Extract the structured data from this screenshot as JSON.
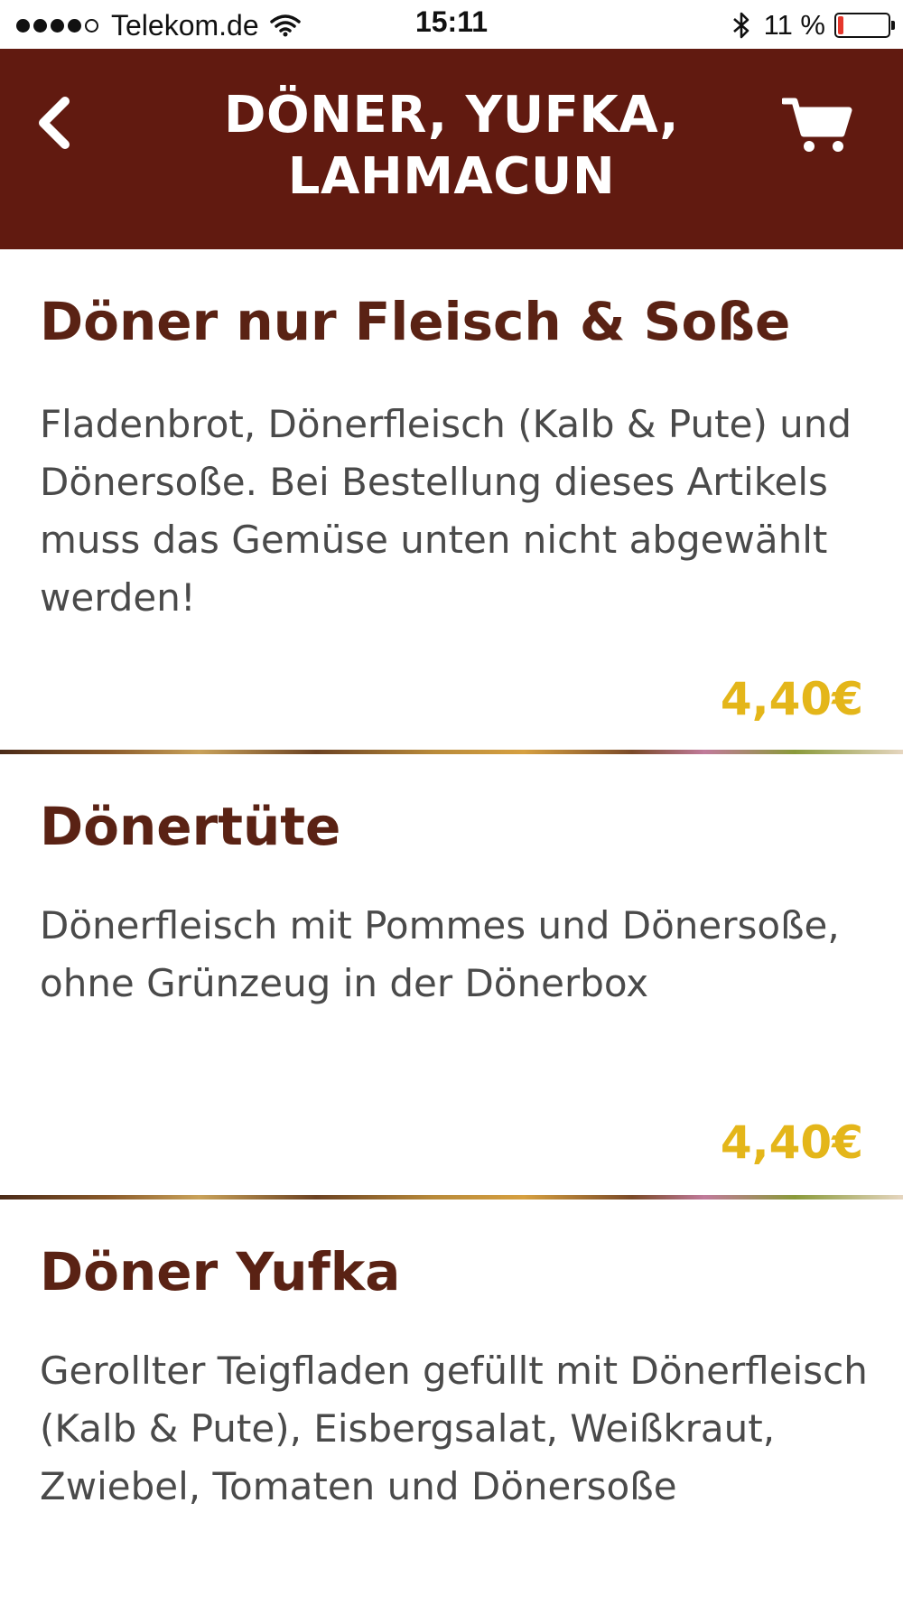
{
  "status_bar": {
    "carrier": "Telekom.de",
    "time": "15:11",
    "battery_percent": "11 %",
    "battery_level": 0.11,
    "signal_bars": 4,
    "battery_color": "#e5372c"
  },
  "header": {
    "title": "DÖNER, YUFKA, LAHMACUN",
    "background_color": "#611a10",
    "back_icon": "chevron-left-icon",
    "cart_icon": "shopping-cart-icon"
  },
  "menu_items": [
    {
      "name": "Döner nur Fleisch & Soße",
      "description": "Fladenbrot, Dönerfleisch (Kalb & Pute) und Dönersoße. Bei Bestellung dieses Artikels muss das Gemüse unten nicht abgewählt werden!",
      "price": "4,40€"
    },
    {
      "name": "Dönertüte",
      "description": "Dönerfleisch mit Pommes und Dönersoße, ohne Grünzeug in der Dönerbox",
      "price": "4,40€"
    },
    {
      "name": "Döner Yufka",
      "description": "Gerollter Teigfladen gefüllt mit Dönerfleisch (Kalb & Pute), Eisbergsalat, Weißkraut, Zwiebel, Tomaten und Dönersoße"
    }
  ],
  "colors": {
    "title": "#5a2214",
    "description": "#4a4a4a",
    "price": "#e4b61a"
  }
}
